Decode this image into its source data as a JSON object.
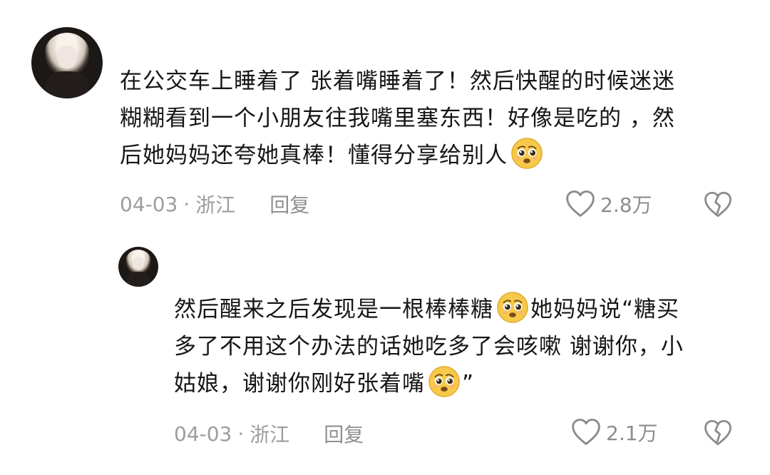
{
  "comment": {
    "text_line1": "在公交车上睡着了 张着嘴睡着了！然后快醒的时候迷迷",
    "text_line2": "糊糊看到一个小朋友往我嘴里塞东西！好像是吃的 ，然",
    "text_line3": "后她妈妈还夸她真棒！懂得分享给别人",
    "date": "04-03",
    "separator": "·",
    "location": "浙江",
    "reply_label": "回复",
    "likes": "2.8万",
    "emoji_icon": "pleading-face-icon"
  },
  "reply": {
    "text_line1": "然后醒来之后发现是一根棒棒糖",
    "text_line1b": "她妈妈说“糖买",
    "text_line2": "多了不用这个办法的话她吃多了会咳嗽 谢谢你，小",
    "text_line3": "姑娘，谢谢你刚好张着嘴",
    "text_line3b": "”",
    "date": "04-03",
    "separator": "·",
    "location": "浙江",
    "reply_label": "回复",
    "likes": "2.1万",
    "emoji_icon": "pleading-face-icon"
  },
  "colors": {
    "text": "#161616",
    "meta": "#9d9d9d",
    "icon": "#8c8c8c",
    "emoji_face": "#f7c948"
  }
}
